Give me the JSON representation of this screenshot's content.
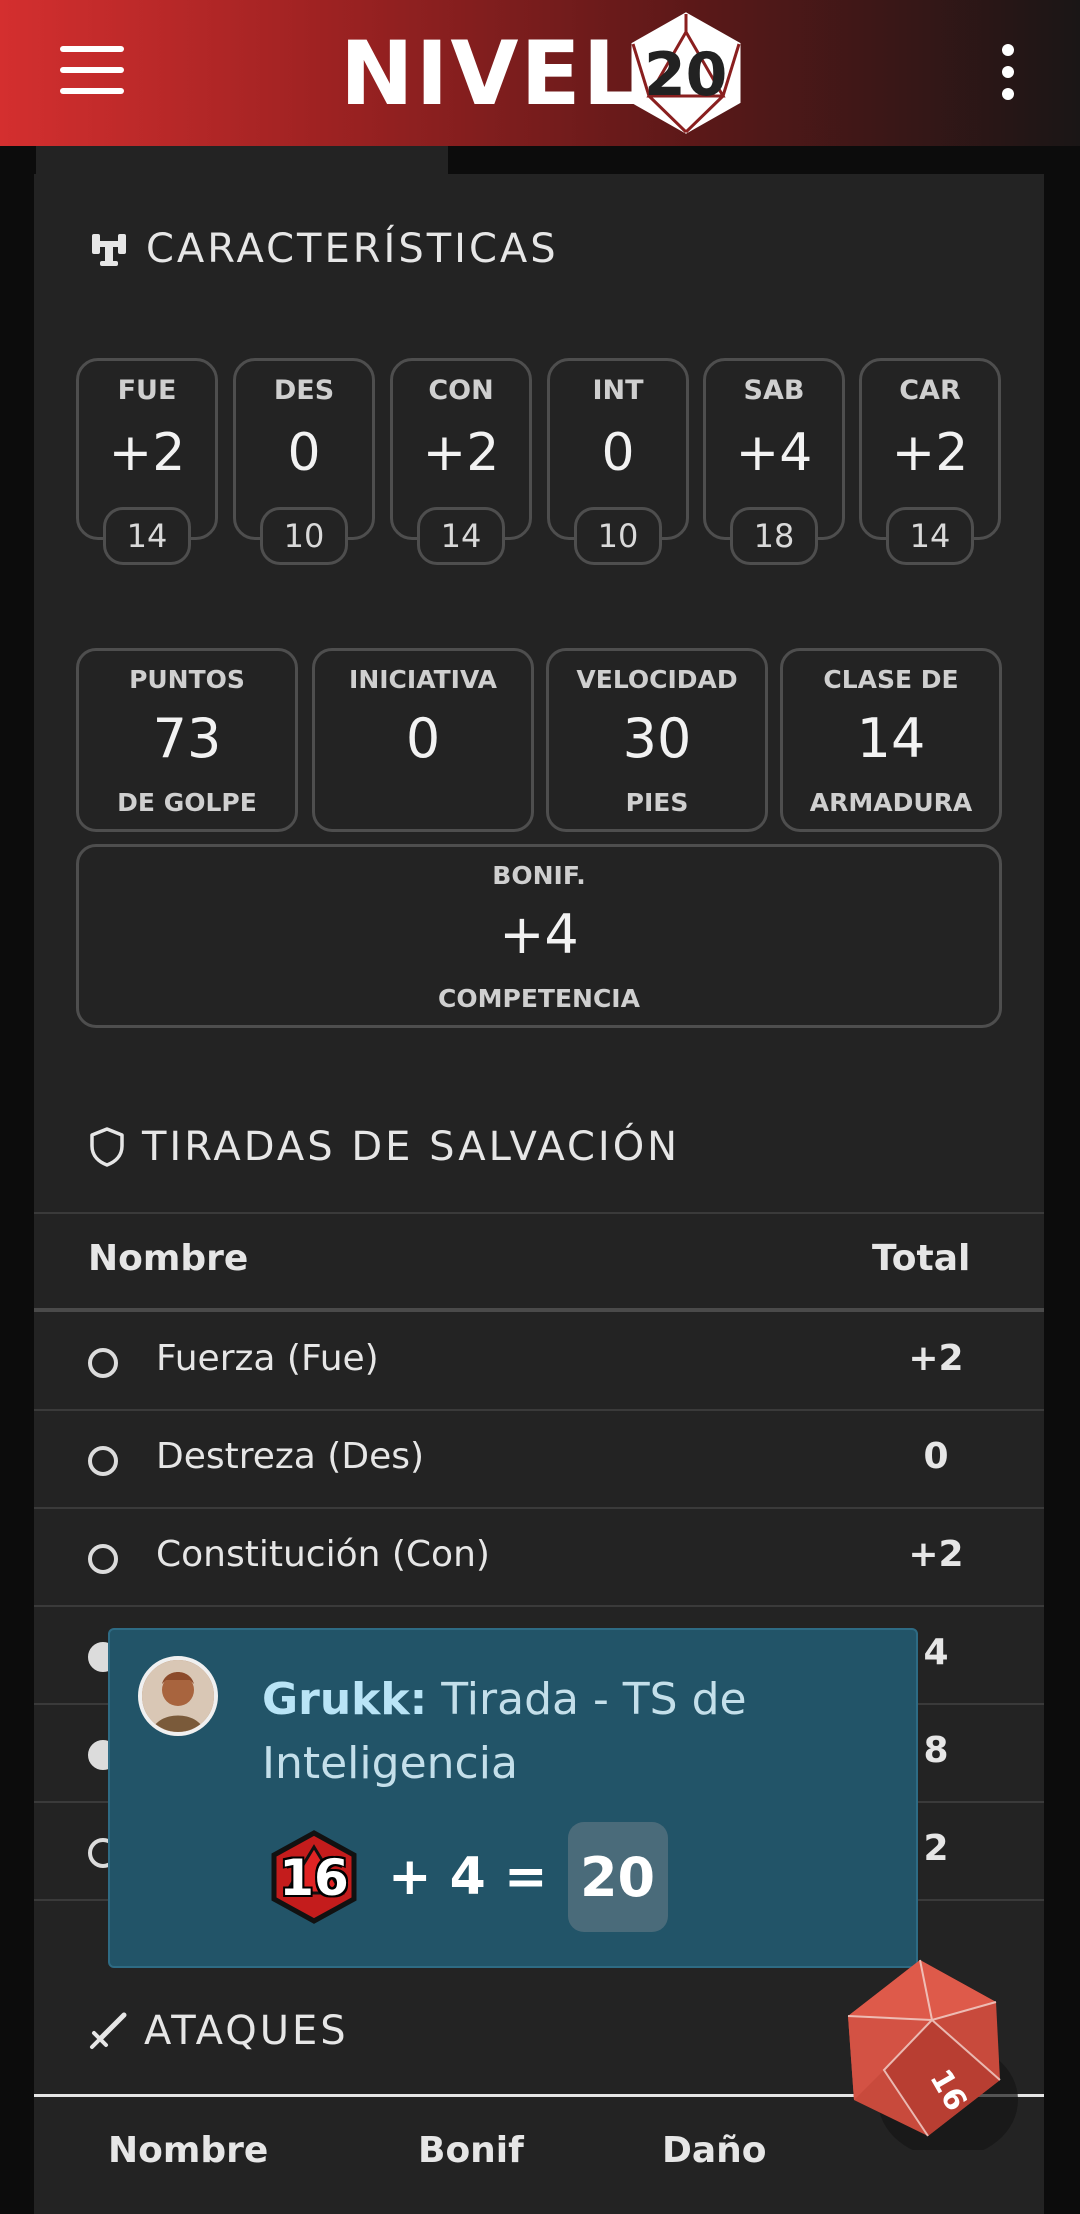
{
  "header": {
    "logo_text": "NIVEL",
    "logo_number": "20"
  },
  "characteristics": {
    "title": "CARACTERÍSTICAS",
    "stats": [
      {
        "abbr": "FUE",
        "mod": "+2",
        "score": "14"
      },
      {
        "abbr": "DES",
        "mod": "0",
        "score": "10"
      },
      {
        "abbr": "CON",
        "mod": "+2",
        "score": "14"
      },
      {
        "abbr": "INT",
        "mod": "0",
        "score": "10"
      },
      {
        "abbr": "SAB",
        "mod": "+4",
        "score": "18"
      },
      {
        "abbr": "CAR",
        "mod": "+2",
        "score": "14"
      }
    ],
    "boxes": [
      {
        "top": "PUNTOS",
        "value": "73",
        "bottom": "DE GOLPE"
      },
      {
        "top": "INICIATIVA",
        "value": "0",
        "bottom": ""
      },
      {
        "top": "VELOCIDAD",
        "value": "30",
        "bottom": "PIES"
      },
      {
        "top": "CLASE DE",
        "value": "14",
        "bottom": "ARMADURA"
      }
    ],
    "proficiency": {
      "top": "BONIF.",
      "value": "+4",
      "bottom": "COMPETENCIA"
    }
  },
  "saving_throws": {
    "title": "TIRADAS DE SALVACIÓN",
    "col_name": "Nombre",
    "col_total": "Total",
    "rows": [
      {
        "name": "Fuerza (Fue)",
        "total": "+2",
        "proficient": false
      },
      {
        "name": "Destreza (Des)",
        "total": "0",
        "proficient": false
      },
      {
        "name": "Constitución (Con)",
        "total": "+2",
        "proficient": false
      },
      {
        "name": "",
        "total": "4",
        "proficient": true
      },
      {
        "name": "",
        "total": "8",
        "proficient": true
      },
      {
        "name": "",
        "total": "2",
        "proficient": false
      }
    ]
  },
  "toast": {
    "character": "Grukk:",
    "message": "Tirada - TS de Inteligencia",
    "die": "16",
    "plus": "+ 4 =",
    "result": "20"
  },
  "attacks": {
    "title": "ATAQUES",
    "col_name": "Nombre",
    "col_bonus": "Bonif",
    "col_damage": "Daño"
  },
  "floating_die": {
    "face": "16"
  }
}
